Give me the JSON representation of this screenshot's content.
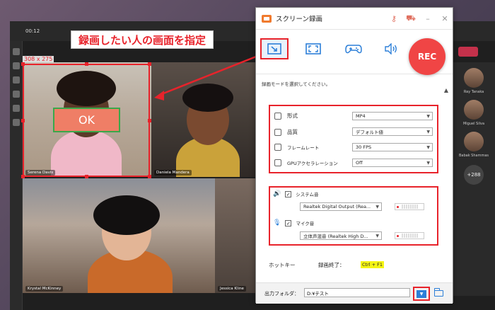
{
  "meeting": {
    "timer": "00:12",
    "participants": [
      {
        "name": "Serena Davis"
      },
      {
        "name": "Daniela Mandera"
      },
      {
        "name": "Krystal McKinney"
      },
      {
        "name": "Jessica Kline"
      }
    ],
    "side_list": [
      {
        "name": "Ray Tanaka"
      },
      {
        "name": "Miguel Silva"
      },
      {
        "name": "Babak Shammas"
      }
    ],
    "more_count": "+288"
  },
  "annotation": {
    "callout_text": "録画したい人の画面を指定",
    "selection_size": "308 x 275",
    "ok_label": "OK",
    "color": "#e8232b"
  },
  "recorder": {
    "title": "スクリーン録画",
    "modes": [
      {
        "icon": "screen-region-icon",
        "active": true
      },
      {
        "icon": "fullscreen-icon",
        "active": false
      },
      {
        "icon": "gamepad-icon",
        "active": false
      },
      {
        "icon": "audio-icon",
        "active": false
      }
    ],
    "rec_label": "REC",
    "hint": "録画モードを選択してください。",
    "video": {
      "format_label": "形式",
      "format_value": "MP4",
      "quality_label": "品質",
      "quality_value": "デフォルト値",
      "framerate_label": "フレームレート",
      "framerate_value": "30 FPS",
      "gpu_label": "GPUアクセラレーション",
      "gpu_value": "Off"
    },
    "audio": {
      "system_label": "システム音",
      "system_checked": true,
      "system_device": "Realtek Digital Output (Rea...",
      "mic_label": "マイク音",
      "mic_checked": true,
      "mic_device": "立体声混音 (Realtek High D..."
    },
    "hotkey": {
      "label": "ホットキー",
      "action": "録画終了：",
      "keys": "Ctrl + F1"
    },
    "output": {
      "label": "出力フォルダ：",
      "path": "D:¥テスト"
    }
  }
}
